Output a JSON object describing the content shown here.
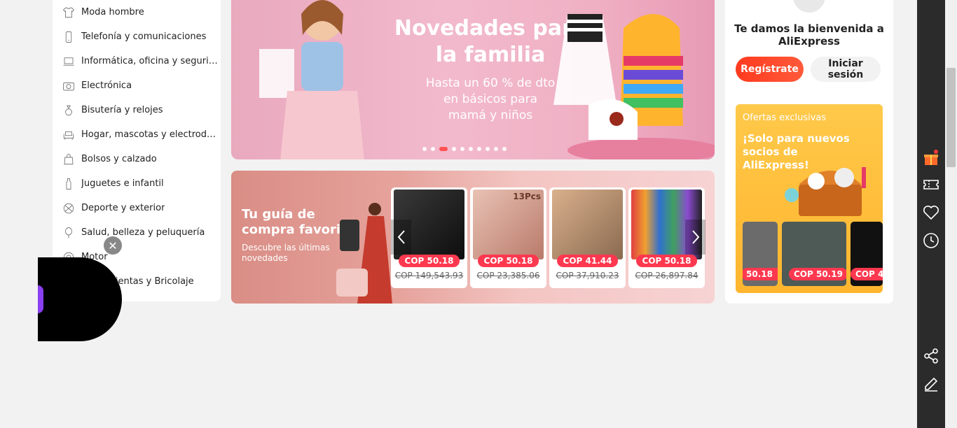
{
  "categories": [
    {
      "label": "Moda hombre",
      "icon": "shirt-icon"
    },
    {
      "label": "Telefonía y comunicaciones",
      "icon": "phone-icon"
    },
    {
      "label": "Informática, oficina y seguridad",
      "icon": "laptop-icon"
    },
    {
      "label": "Electrónica",
      "icon": "camera-icon"
    },
    {
      "label": "Bisutería y relojes",
      "icon": "ring-icon"
    },
    {
      "label": "Hogar, mascotas y electrodom...",
      "icon": "sofa-icon"
    },
    {
      "label": "Bolsos y calzado",
      "icon": "bag-icon"
    },
    {
      "label": "Juguetes e infantil",
      "icon": "bottle-icon"
    },
    {
      "label": "Deporte y exterior",
      "icon": "ball-icon"
    },
    {
      "label": "Salud, belleza y peluquería",
      "icon": "mirror-icon"
    },
    {
      "label": "Motor",
      "icon": "wheel-icon"
    },
    {
      "label": "Herramientas y Bricolaje",
      "icon": "tools-icon"
    }
  ],
  "hero": {
    "title_line1": "Novedades para",
    "title_line2": "la familia",
    "subtitle_line1": "Hasta un 60 % de dto",
    "subtitle_line2": "en básicos para",
    "subtitle_line3": "mamá y niños",
    "dot_count": 10,
    "active_dot": 2
  },
  "guide": {
    "title": "Tu guía de compra favorita",
    "subtitle": "Descubre las últimas novedades",
    "products": [
      {
        "price": "COP 50.18",
        "old_price": "COP 149,543.93",
        "image": "watch",
        "badge": ""
      },
      {
        "price": "COP 50.18",
        "old_price": "COP 23,385.06",
        "image": "brushes",
        "badge": "13Pcs"
      },
      {
        "price": "COP 41.44",
        "old_price": "COP 37,910.23",
        "image": "sunglasses",
        "badge": ""
      },
      {
        "price": "COP 50.18",
        "old_price": "COP 26,897.84",
        "image": "beanies",
        "badge": ""
      }
    ]
  },
  "panel": {
    "welcome": "Te damos la bienvenida a AliExpress",
    "register_label": "Regístrate",
    "login_label": "Iniciar sesión",
    "offers_tag": "Ofertas exclusivas",
    "offers_heading": "¡Solo para nuevos socios de AliExpress!",
    "mini_prices": [
      "50.18",
      "COP 50.19",
      "COP 4"
    ]
  },
  "toolbar": [
    "gift-icon",
    "coupon-icon",
    "heart-icon",
    "history-icon",
    "share-icon",
    "edit-icon"
  ],
  "overlay": {
    "close_label": "✕"
  },
  "colors": {
    "accent": "#ff4747",
    "price_badge": "#fd384f",
    "toolbar": "#2b2b2b"
  }
}
